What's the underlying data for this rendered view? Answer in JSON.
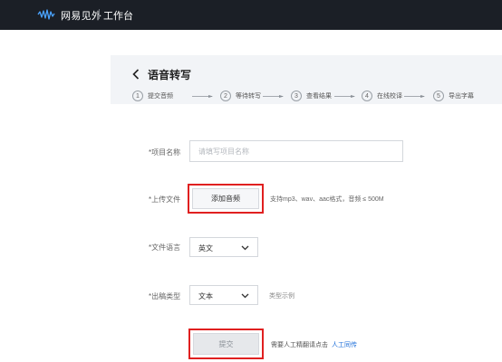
{
  "topbar": {
    "logo_icon": "netease-wave-logo-icon",
    "brand": "网易见外",
    "workspace": "工作台",
    "logo_color": "#4aa3ff"
  },
  "header": {
    "back_icon": "chevron-left-icon",
    "title": "语音转写",
    "steps": [
      {
        "num": "1",
        "label": "提交音频"
      },
      {
        "num": "2",
        "label": "等待转写"
      },
      {
        "num": "3",
        "label": "查看结果"
      },
      {
        "num": "4",
        "label": "在线校译"
      },
      {
        "num": "5",
        "label": "导出字幕"
      }
    ]
  },
  "form": {
    "project_name": {
      "label": "*项目名称",
      "value": "",
      "placeholder": "请填写项目名称"
    },
    "upload": {
      "label": "*上传文件",
      "button": "添加音频",
      "hint": "支持mp3、wav、aac格式，音频 ≤ 500M"
    },
    "language": {
      "label": "*文件语言",
      "selected": "英文"
    },
    "output_type": {
      "label": "*出稿类型",
      "selected": "文本",
      "example_link": "类型示例"
    },
    "submit": {
      "button": "提交",
      "note": "需要人工精翻请点击",
      "link": "人工同传"
    }
  },
  "colors": {
    "topbar_bg": "#1b1f26",
    "link": "#1e6fd9",
    "highlight": "#e02020"
  }
}
